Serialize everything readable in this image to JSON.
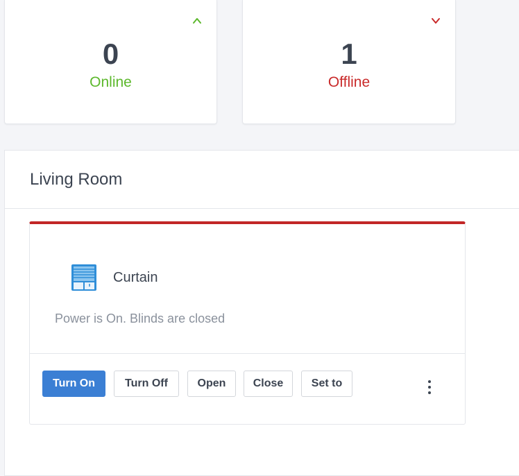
{
  "summary": {
    "online": {
      "count": "0",
      "label": "Online",
      "color": "#5cb82c",
      "icon": "chevron-up-icon"
    },
    "offline": {
      "count": "1",
      "label": "Offline",
      "color": "#c92a2a",
      "icon": "chevron-down-icon"
    }
  },
  "room": {
    "title": "Living Room",
    "device": {
      "icon": "curtain-icon",
      "name": "Curtain",
      "status": "Power is On. Blinds are closed",
      "accent_color": "#c22626",
      "actions": {
        "turn_on": "Turn On",
        "turn_off": "Turn Off",
        "open": "Open",
        "close": "Close",
        "set_to": "Set to"
      },
      "more_icon": "more-vertical-icon"
    }
  },
  "colors": {
    "primary": "#3b7fd4",
    "background": "#f4f5f8"
  }
}
